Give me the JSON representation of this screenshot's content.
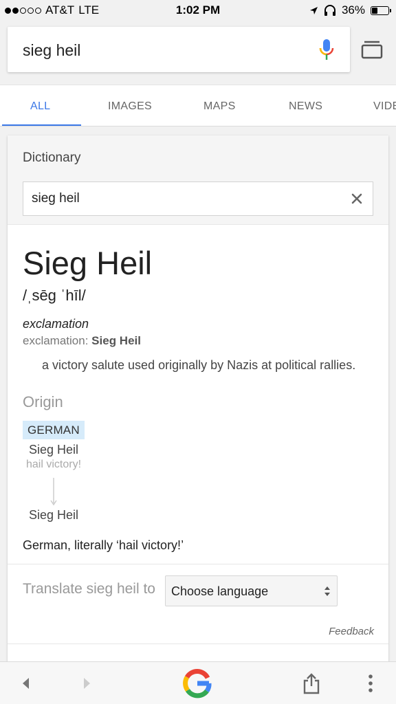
{
  "status_bar": {
    "carrier": "AT&T",
    "network": "LTE",
    "time": "1:02 PM",
    "battery": "36%",
    "battery_level": 0.36
  },
  "search": {
    "query": "sieg heil"
  },
  "tabs": [
    {
      "label": "ALL",
      "active": true
    },
    {
      "label": "IMAGES",
      "active": false
    },
    {
      "label": "MAPS",
      "active": false
    },
    {
      "label": "NEWS",
      "active": false
    },
    {
      "label": "VIDEOS",
      "active": false
    }
  ],
  "dictionary": {
    "title": "Dictionary",
    "input_value": "sieg heil",
    "headword": "Sieg Heil",
    "phonetic": "/ˌsēɡ ˈhīl/",
    "part_of_speech": "exclamation",
    "form_label": "exclamation:",
    "form_value": "Sieg Heil",
    "definition": "a victory salute used originally by Nazis at political rallies.",
    "origin": {
      "title": "Origin",
      "language": "GERMAN",
      "source_word": "Sieg Heil",
      "source_gloss": "hail victory!",
      "result_word": "Sieg Heil",
      "note": "German, literally ‘hail victory!’"
    },
    "translate": {
      "label": "Translate sieg heil to",
      "select_value": "Choose language"
    },
    "feedback": "Feedback"
  },
  "colors": {
    "accent": "#3b78e7",
    "chip": "#d6ebfa"
  }
}
